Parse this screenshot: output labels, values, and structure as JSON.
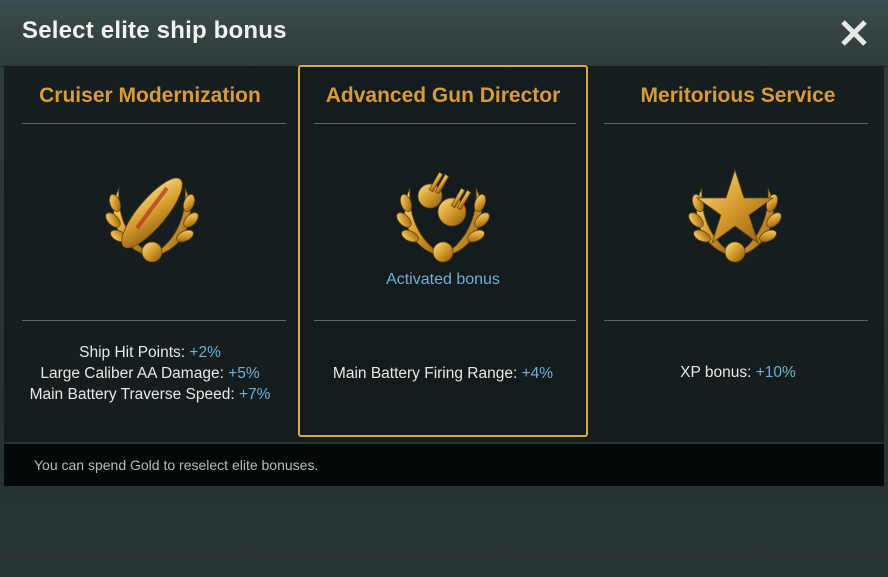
{
  "dialog": {
    "title": "Select elite ship bonus",
    "close_icon": "close-icon"
  },
  "cards": [
    {
      "title": "Cruiser Modernization",
      "icon": "cruiser-modernization-medal-icon",
      "selected": false,
      "stats": [
        {
          "label": "Ship Hit Points: ",
          "value": "+2%"
        },
        {
          "label": "Large Caliber AA Damage: ",
          "value": "+5%"
        },
        {
          "label": "Main Battery Traverse Speed: ",
          "value": "+7%"
        }
      ]
    },
    {
      "title": "Advanced Gun Director",
      "icon": "gun-director-medal-icon",
      "selected": true,
      "status": "Activated bonus",
      "stats": [
        {
          "label": "Main Battery Firing Range: ",
          "value": "+4%"
        }
      ]
    },
    {
      "title": "Meritorious Service",
      "icon": "star-medal-icon",
      "selected": false,
      "stats": [
        {
          "label": "XP bonus: ",
          "value": "+10%"
        }
      ]
    }
  ],
  "footer": {
    "note": "You can spend Gold to reselect elite bonuses."
  },
  "colors": {
    "accent_gold": "#d99a3a",
    "selected_border": "#d9a93a",
    "value_blue": "#6fb0d8"
  }
}
